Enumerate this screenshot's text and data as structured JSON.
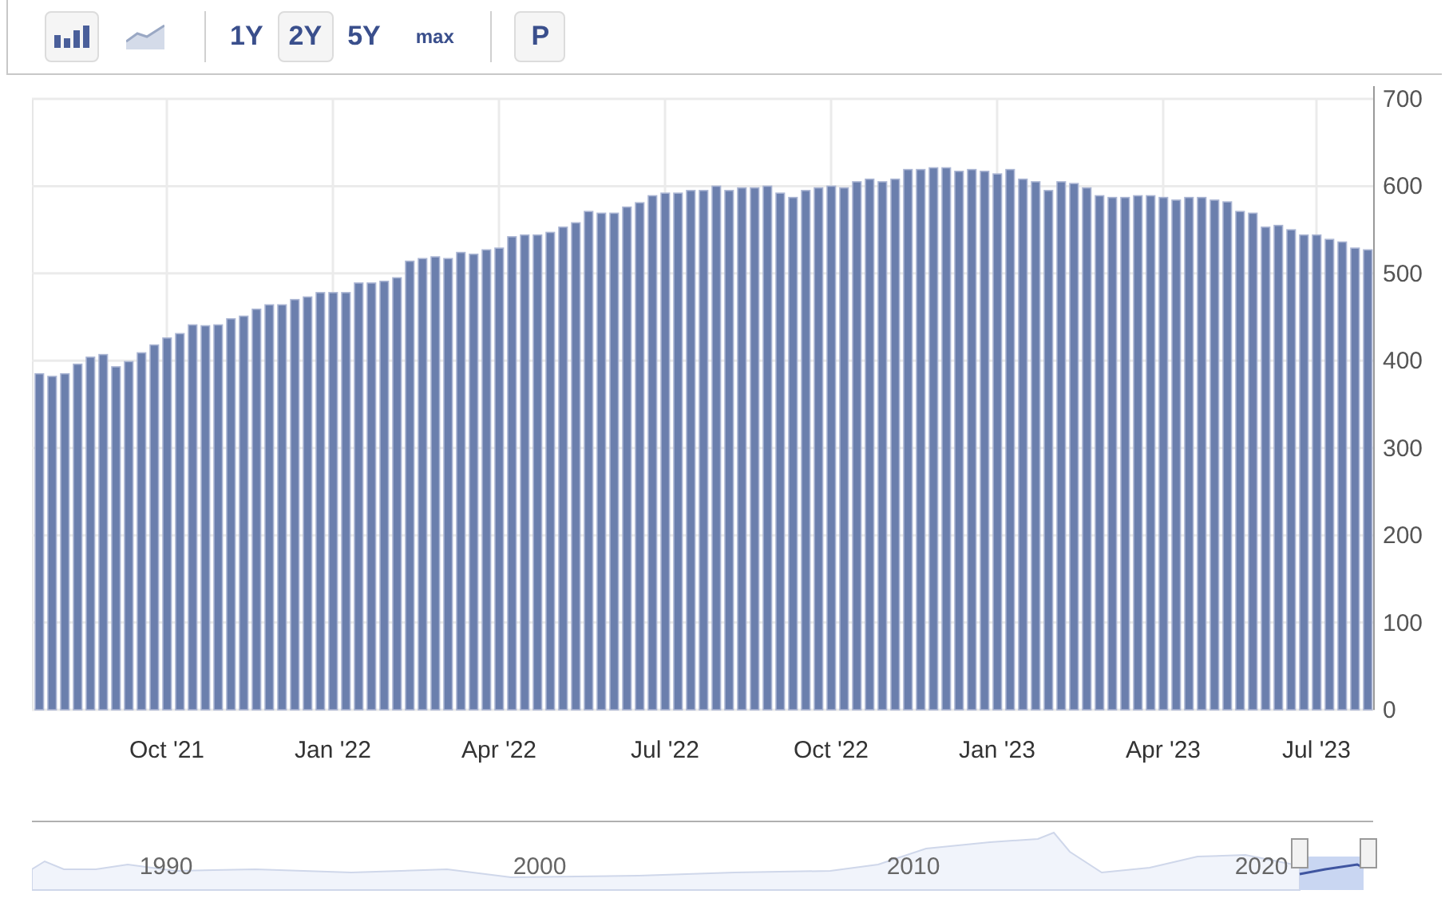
{
  "toolbar": {
    "chart_types": [
      {
        "kind": "bar",
        "selected": true
      },
      {
        "kind": "area",
        "selected": false
      }
    ],
    "ranges": [
      {
        "label": "1Y",
        "selected": false
      },
      {
        "label": "2Y",
        "selected": true
      },
      {
        "label": "5Y",
        "selected": false
      },
      {
        "label": "max",
        "selected": false
      }
    ],
    "extra_button": {
      "label": "P"
    }
  },
  "chart": {
    "chart_data": {
      "type": "bar",
      "ylim": [
        0,
        700
      ],
      "yticks": [
        0,
        100,
        200,
        300,
        400,
        500,
        600,
        700
      ],
      "grid": true,
      "categories": [
        null,
        null,
        null,
        null,
        null,
        null,
        null,
        null,
        null,
        null,
        "Oct '21",
        null,
        null,
        null,
        null,
        null,
        null,
        null,
        null,
        null,
        null,
        null,
        null,
        "Jan '22",
        null,
        null,
        null,
        null,
        null,
        null,
        null,
        null,
        null,
        null,
        null,
        null,
        "Apr '22",
        null,
        null,
        null,
        null,
        null,
        null,
        null,
        null,
        null,
        null,
        null,
        null,
        "Jul '22",
        null,
        null,
        null,
        null,
        null,
        null,
        null,
        null,
        null,
        null,
        null,
        null,
        "Oct '22",
        null,
        null,
        null,
        null,
        null,
        null,
        null,
        null,
        null,
        null,
        null,
        null,
        "Jan '23",
        null,
        null,
        null,
        null,
        null,
        null,
        null,
        null,
        null,
        null,
        null,
        null,
        "Apr '23",
        null,
        null,
        null,
        null,
        null,
        null,
        null,
        null,
        null,
        null,
        null,
        "Jul '23",
        null,
        null,
        null,
        null
      ],
      "values": [
        385,
        382,
        385,
        396,
        404,
        407,
        393,
        399,
        409,
        418,
        426,
        431,
        441,
        440,
        441,
        448,
        451,
        459,
        464,
        464,
        470,
        473,
        478,
        478,
        478,
        489,
        489,
        491,
        495,
        514,
        517,
        519,
        517,
        524,
        522,
        527,
        529,
        542,
        544,
        544,
        547,
        553,
        558,
        571,
        569,
        569,
        576,
        581,
        589,
        592,
        592,
        595,
        595,
        600,
        595,
        598,
        598,
        600,
        592,
        587,
        595,
        598,
        600,
        598,
        605,
        608,
        605,
        608,
        619,
        619,
        621,
        621,
        617,
        619,
        617,
        614,
        619,
        608,
        605,
        595,
        605,
        603,
        598,
        589,
        587,
        587,
        589,
        589,
        587,
        584,
        587,
        587,
        584,
        582,
        571,
        569,
        553,
        555,
        550,
        544,
        544,
        539,
        536,
        529,
        527
      ]
    }
  },
  "navigator": {
    "year_labels": [
      "1990",
      "2000",
      "2010",
      "2020"
    ]
  }
}
